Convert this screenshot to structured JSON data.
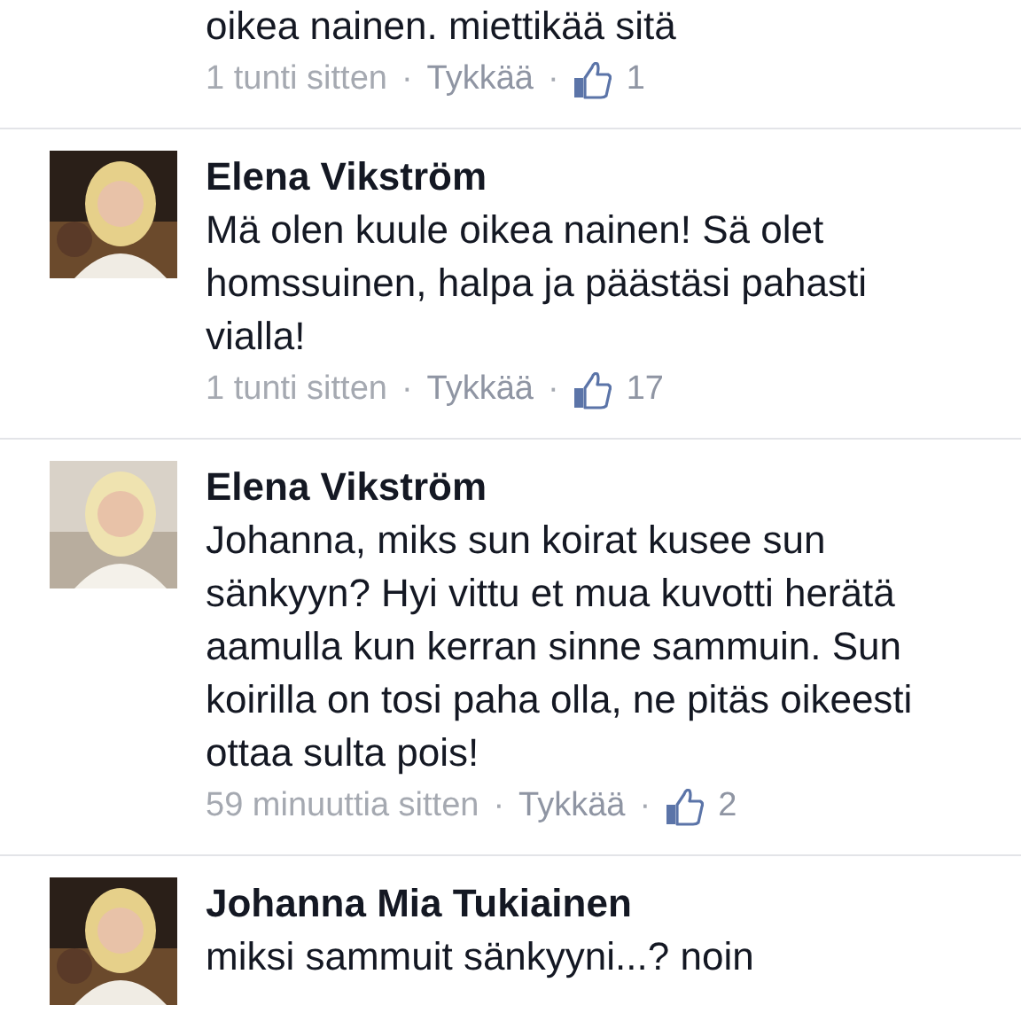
{
  "comments": [
    {
      "text": "oikea nainen. miettikää sitä",
      "time": "1 tunti sitten",
      "separator": "·",
      "like_label": "Tykkää",
      "likes": "1"
    },
    {
      "author": "Elena Vikström",
      "text": "Mä olen kuule oikea nainen! Sä olet homssuinen, halpa ja päästäsi pahasti vialla!",
      "time": "1 tunti sitten",
      "separator": "·",
      "like_label": "Tykkää",
      "likes": "17"
    },
    {
      "author": "Elena Vikström",
      "text": "Johanna, miks sun koirat kusee sun sänkyyn? Hyi vittu et mua kuvotti herätä aamulla kun kerran sinne sammuin. Sun koirilla on tosi paha olla, ne pitäs oikeesti ottaa sulta pois!",
      "time": "59 minuuttia sitten",
      "separator": "·",
      "like_label": "Tykkää",
      "likes": "2"
    },
    {
      "author": "Johanna Mia Tukiainen",
      "text": "miksi sammuit sänkyyni...? noin"
    }
  ]
}
